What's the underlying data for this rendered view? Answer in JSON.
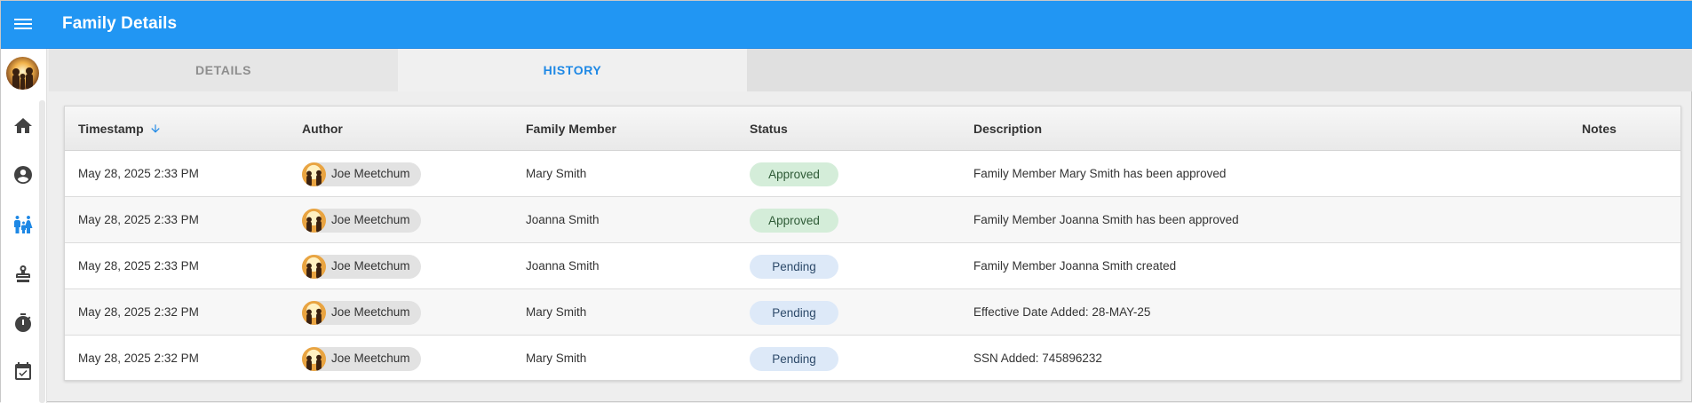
{
  "app": {
    "title": "Family Details"
  },
  "sidebar": {
    "items": [
      {
        "icon": "home-icon"
      },
      {
        "icon": "account-circle-icon"
      },
      {
        "icon": "family-icon",
        "active": true
      },
      {
        "icon": "stamp-icon"
      },
      {
        "icon": "timer-icon"
      },
      {
        "icon": "calendar-check-icon"
      }
    ]
  },
  "tabs": [
    {
      "label": "DETAILS",
      "active": false
    },
    {
      "label": "HISTORY",
      "active": true
    }
  ],
  "table": {
    "columns": [
      "Timestamp",
      "Author",
      "Family Member",
      "Status",
      "Description",
      "Notes"
    ],
    "sort": {
      "column": "Timestamp",
      "direction": "descending"
    },
    "rows": [
      {
        "timestamp": "May 28, 2025 2:33 PM",
        "author": "Joe Meetchum",
        "member": "Mary Smith",
        "status": "Approved",
        "description": "Family Member Mary Smith has been approved",
        "notes": ""
      },
      {
        "timestamp": "May 28, 2025 2:33 PM",
        "author": "Joe Meetchum",
        "member": "Joanna Smith",
        "status": "Approved",
        "description": "Family Member Joanna Smith has been approved",
        "notes": ""
      },
      {
        "timestamp": "May 28, 2025 2:33 PM",
        "author": "Joe Meetchum",
        "member": "Joanna Smith",
        "status": "Pending",
        "description": "Family Member Joanna Smith created",
        "notes": ""
      },
      {
        "timestamp": "May 28, 2025 2:32 PM",
        "author": "Joe Meetchum",
        "member": "Mary Smith",
        "status": "Pending",
        "description": "Effective Date Added: 28-MAY-25",
        "notes": ""
      },
      {
        "timestamp": "May 28, 2025 2:32 PM",
        "author": "Joe Meetchum",
        "member": "Mary Smith",
        "status": "Pending",
        "description": "SSN Added: 745896232",
        "notes": ""
      }
    ]
  },
  "colors": {
    "primary": "#2196f3",
    "active_tab": "#1e88e5",
    "approved_bg": "#d4edd9",
    "pending_bg": "#dde9f8"
  }
}
